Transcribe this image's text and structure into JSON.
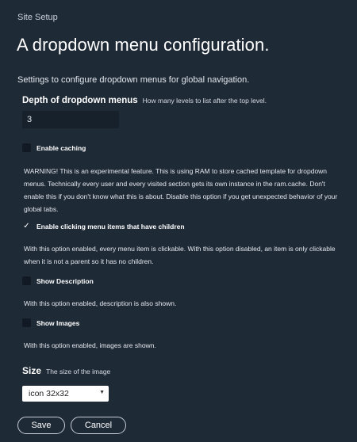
{
  "breadcrumb": "Site Setup",
  "title": "A dropdown menu configuration.",
  "description": "Settings to configure dropdown menus for global navigation.",
  "depth": {
    "label": "Depth of dropdown menus",
    "help": "How many levels to list after the top level.",
    "value": "3"
  },
  "caching": {
    "label": "Enable caching",
    "checked": false,
    "help": "WARNING! This is an experimental feature. This is using RAM to store cached template for dropdown menus. Technically every user and every visited section gets its own instance in the ram.cache. Don't enable this if you don't know what this is about. Disable this option if you get unexpected behavior of your global tabs."
  },
  "clickable": {
    "label": "Enable clicking menu items that have children",
    "checked": true,
    "help": "With this option enabled, every menu item is clickable. With this option disabled, an item is only clickable when it is not a parent so it has no children."
  },
  "show_description": {
    "label": "Show Description",
    "checked": false,
    "help": "With this option enabled, description is also shown."
  },
  "show_images": {
    "label": "Show Images",
    "checked": false,
    "help": "With this option enabled, images are shown."
  },
  "size": {
    "label": "Size",
    "help": "The size of the image",
    "selected": "icon 32x32"
  },
  "buttons": {
    "save": "Save",
    "cancel": "Cancel"
  },
  "icons": {
    "check": "check-icon",
    "chevron": "chevron-down-icon"
  }
}
